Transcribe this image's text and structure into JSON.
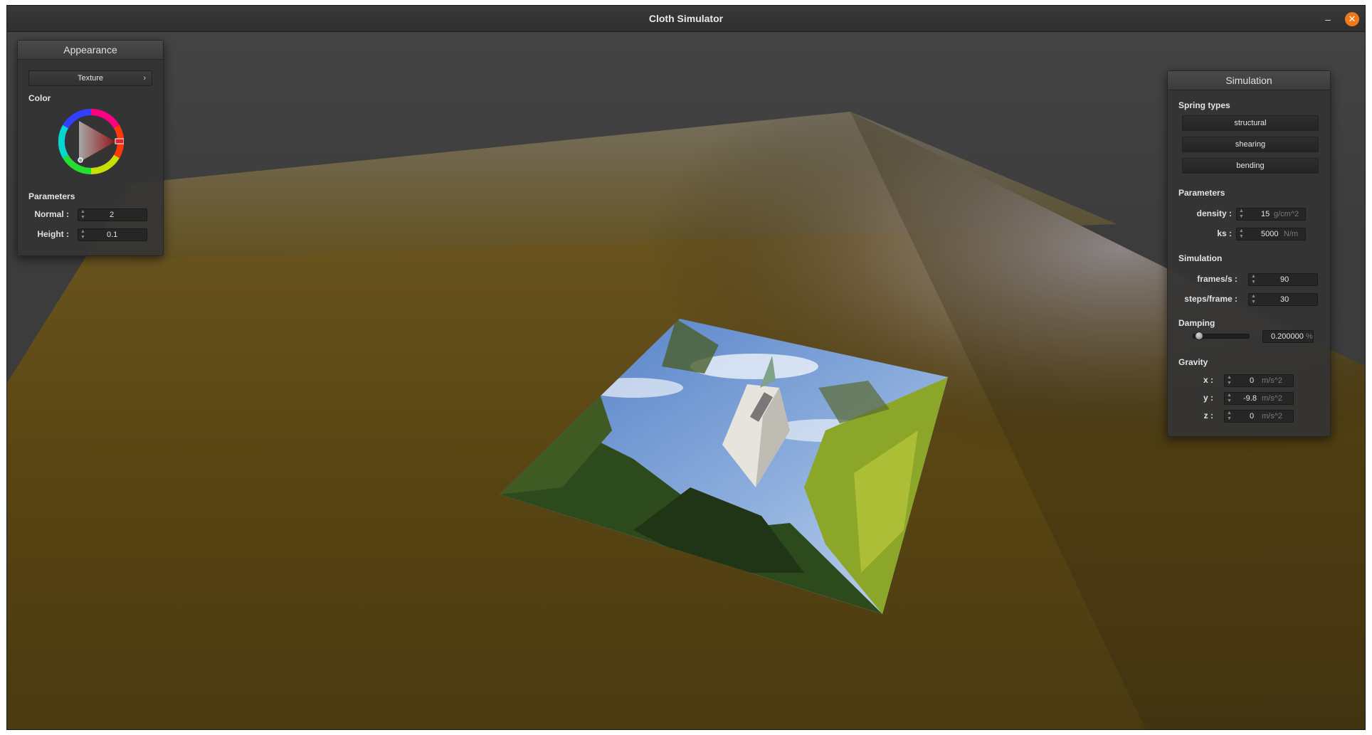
{
  "window": {
    "title": "Cloth Simulator",
    "minimize_icon": "minimize-icon",
    "close_icon": "close-icon",
    "minimize_glyph": "–",
    "close_glyph": "✕",
    "accent": "#f07a1a"
  },
  "appearance": {
    "title": "Appearance",
    "texture_button": "Texture",
    "texture_chevron": "›",
    "color_label": "Color",
    "color_wheel": {
      "selected_color": "#e0262a"
    },
    "parameters_label": "Parameters",
    "params": [
      {
        "label": "Normal :",
        "value": "2"
      },
      {
        "label": "Height :",
        "value": "0.1"
      }
    ]
  },
  "simulation_panel": {
    "title": "Simulation",
    "spring_types_label": "Spring types",
    "spring_types": [
      "structural",
      "shearing",
      "bending"
    ],
    "parameters_label": "Parameters",
    "params": [
      {
        "label": "density :",
        "value": "15",
        "unit": "g/cm^2"
      },
      {
        "label": "ks :",
        "value": "5000",
        "unit": "N/m"
      }
    ],
    "simulation_label": "Simulation",
    "sim_params": [
      {
        "label": "frames/s :",
        "value": "90"
      },
      {
        "label": "steps/frame :",
        "value": "30"
      }
    ],
    "damping_label": "Damping",
    "damping": {
      "value": "0.200000",
      "unit": "%",
      "slider_fraction": 0.2
    },
    "gravity_label": "Gravity",
    "gravity": [
      {
        "label": "x :",
        "value": "0",
        "unit": "m/s^2"
      },
      {
        "label": "y :",
        "value": "-9.8",
        "unit": "m/s^2"
      },
      {
        "label": "z :",
        "value": "0",
        "unit": "m/s^2"
      }
    ]
  },
  "scene": {
    "cloth_color": "#5e4a12",
    "texture_sky": "#6f95cf",
    "texture_tower": "#e6e4dc",
    "texture_foliage": "#3f5a22"
  }
}
